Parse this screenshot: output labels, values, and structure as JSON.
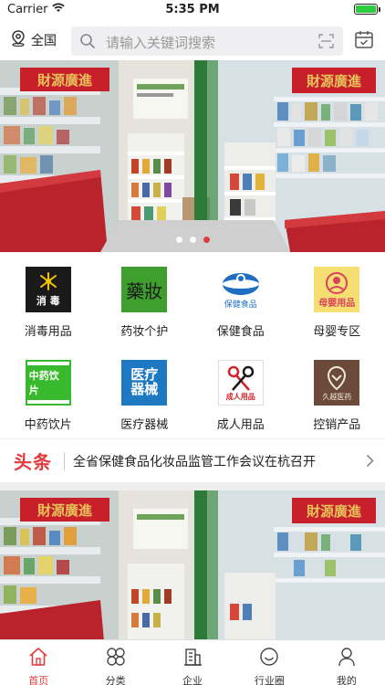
{
  "status_bar": {
    "carrier": "Carrier",
    "time": "5:35 PM",
    "battery_level": 1.0
  },
  "header": {
    "location": "全国",
    "search_placeholder": "请输入关键词搜索"
  },
  "banner": {
    "dots": 3,
    "active_dot": 2
  },
  "categories": [
    {
      "label": "消毒用品",
      "icon": "disinfection-icon",
      "tile_text": "消 毒"
    },
    {
      "label": "药妆个护",
      "icon": "cosmeceutical-icon",
      "tile_text": "藥妝"
    },
    {
      "label": "保健食品",
      "icon": "health-food-icon",
      "tile_text": "保健食品"
    },
    {
      "label": "母婴专区",
      "icon": "maternal-baby-icon",
      "tile_text": "母婴用品"
    },
    {
      "label": "中药饮片",
      "icon": "herbal-icon",
      "tile_text": "中药饮片"
    },
    {
      "label": "医疗器械",
      "icon": "medical-device-icon",
      "tile_text_1": "医疗",
      "tile_text_2": "器械"
    },
    {
      "label": "成人用品",
      "icon": "adult-products-icon",
      "tile_text": "成人用品"
    },
    {
      "label": "控销产品",
      "icon": "controlled-sales-icon",
      "tile_text": "久越医药"
    }
  ],
  "headline": {
    "tag": "头条",
    "text": "全省保健食品化妆品监管工作会议在杭召开"
  },
  "tabs": [
    {
      "label": "首页",
      "icon": "home-icon",
      "active": true
    },
    {
      "label": "分类",
      "icon": "category-icon",
      "active": false
    },
    {
      "label": "企业",
      "icon": "building-icon",
      "active": false
    },
    {
      "label": "行业圈",
      "icon": "circle-icon",
      "active": false
    },
    {
      "label": "我的",
      "icon": "user-icon",
      "active": false
    }
  ],
  "colors": {
    "accent": "#e4393c",
    "banner_red": "#c8202a",
    "shelf_white": "#e9eef0"
  }
}
